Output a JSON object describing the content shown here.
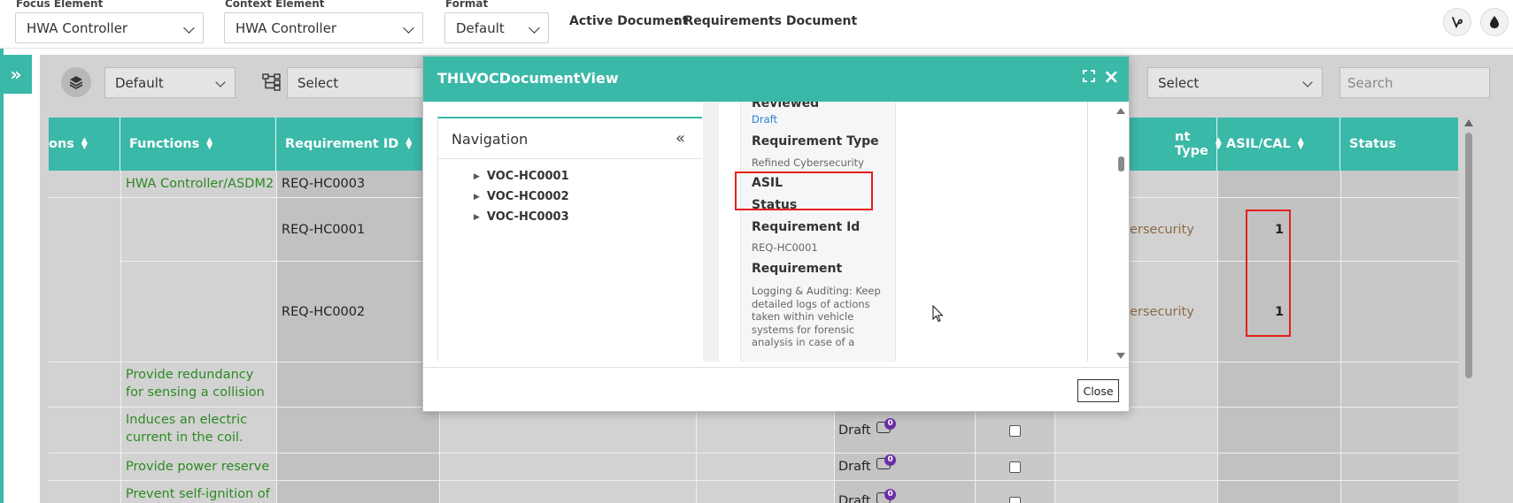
{
  "topbar": {
    "focus_label": "Focus Element",
    "focus_value": "HWA Controller",
    "context_label": "Context Element",
    "context_value": "HWA Controller",
    "format_label": "Format",
    "format_value": "Default",
    "active_doc_label": "Active Document",
    "active_doc_value": ": Requirements Document",
    "icons": [
      "vine-icon",
      "drop-icon"
    ]
  },
  "toolbar": {
    "layer_select": "Default",
    "hierarchy_select": "Select",
    "right_select": "Select",
    "search_placeholder": "Search"
  },
  "table": {
    "columns": [
      "ons",
      "Functions",
      "Requirement ID",
      "nt Type",
      "ASIL/CAL",
      "Status"
    ],
    "rows": [
      {
        "function": "HWA Controller/ASDM2",
        "req_id": "REQ-HC0003"
      },
      {
        "function": "",
        "req_id": "REQ-HC0001",
        "type": "ersecurity",
        "asil": "1"
      },
      {
        "function": "",
        "req_id": "REQ-HC0002",
        "type": "ersecurity",
        "asil": "1"
      },
      {
        "function": "Provide redundancy for sensing a collision"
      },
      {
        "function": "Induces an electric current in the coil.",
        "status": "Draft",
        "comments": "0"
      },
      {
        "function": "Provide power reserve",
        "status": "Draft",
        "comments": "0"
      },
      {
        "function": "Prevent self-ignition of",
        "status": "Draft",
        "comments": "0"
      }
    ]
  },
  "modal": {
    "title": "THLVOCDocumentView",
    "navigation_title": "Navigation",
    "nav_items": [
      "VOC-HC0001",
      "VOC-HC0002",
      "VOC-HC0003"
    ],
    "details": {
      "reviewed_label": "Reviewed",
      "reviewed_value": "Draft",
      "type_label": "Requirement Type",
      "type_value": "Refined Cybersecurity",
      "asil_label": "ASIL",
      "status_label": "Status",
      "id_label": "Requirement Id",
      "id_value": "REQ-HC0001",
      "req_label": "Requirement",
      "req_value": "Logging & Auditing: Keep detailed logs of actions taken within vehicle systems for forensic analysis in case of a"
    },
    "close_label": "Close"
  },
  "colors": {
    "accent": "#3ab8a8",
    "highlight_box": "#e5201b",
    "function_text": "#2c8a22",
    "type_text": "#8a6a47",
    "comment_badge": "#6b2ea6"
  }
}
